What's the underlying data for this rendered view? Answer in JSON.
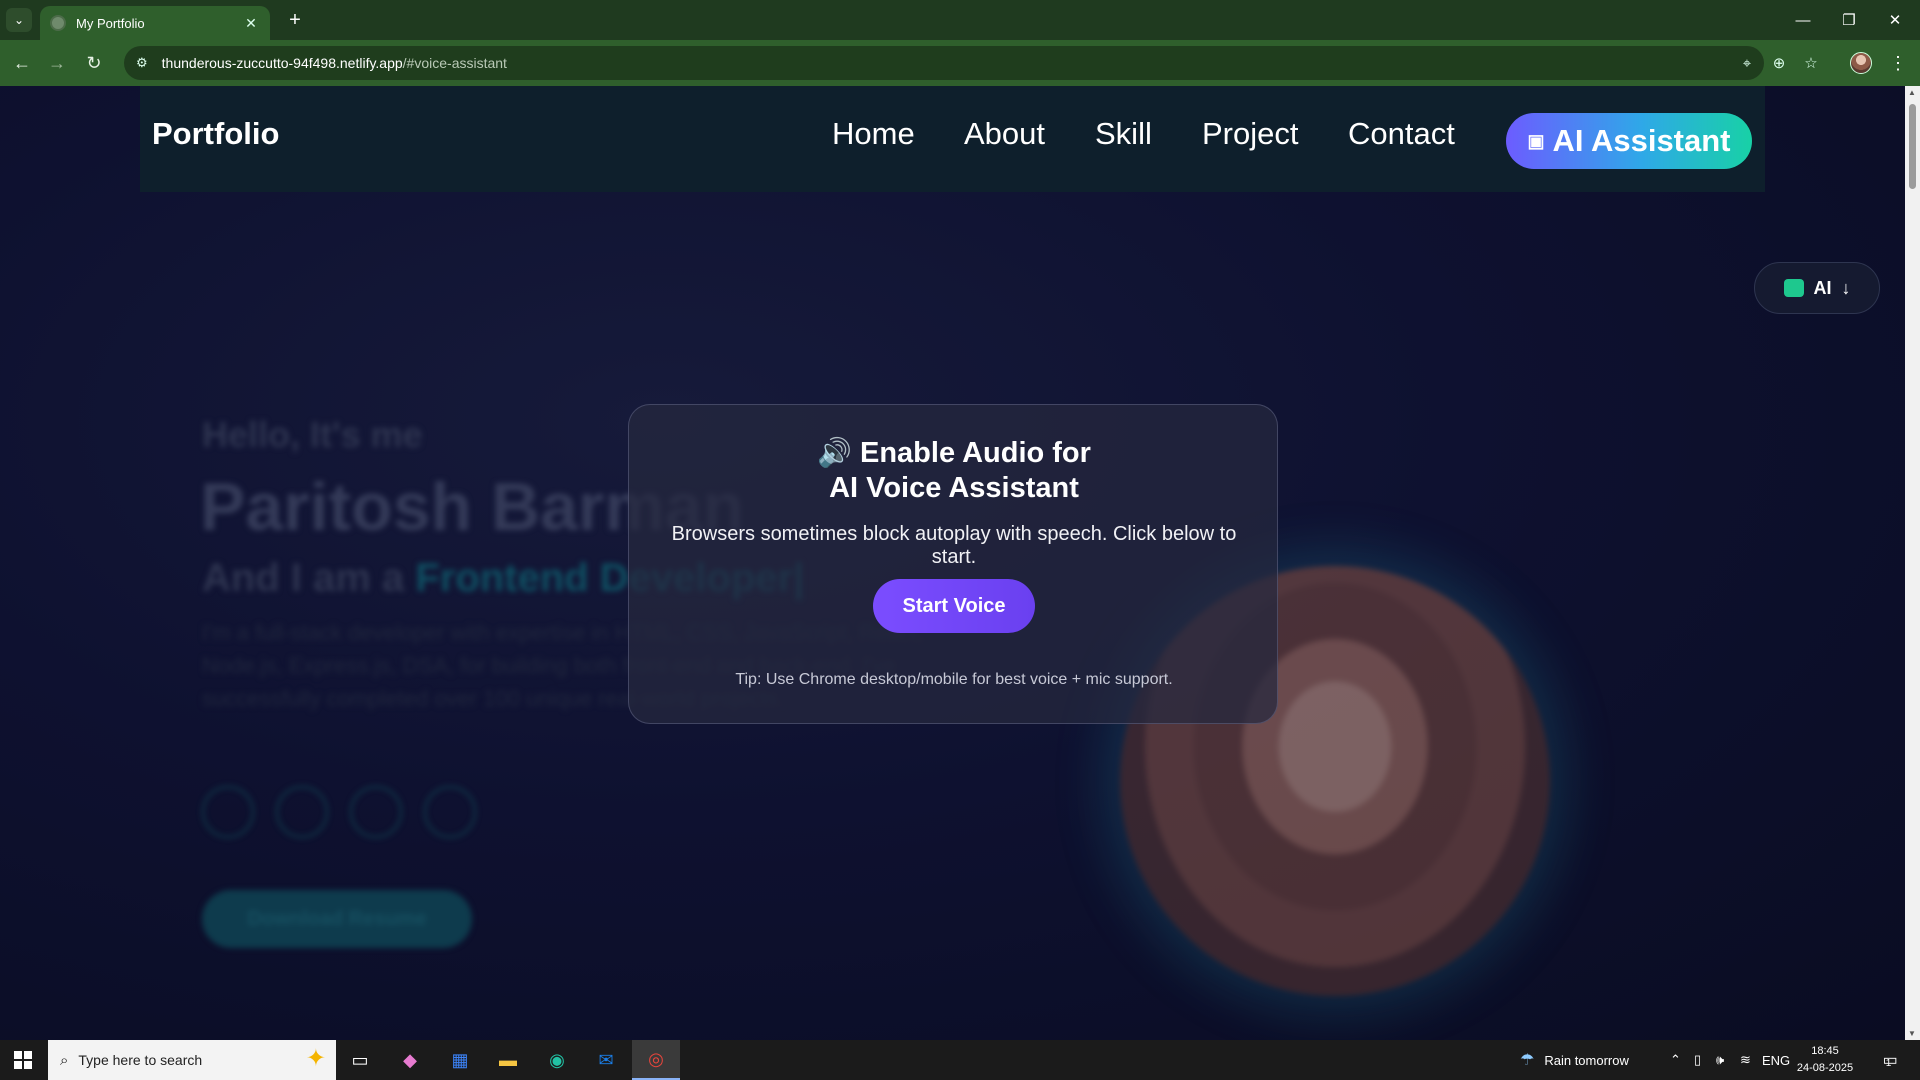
{
  "browser": {
    "tab_title": "My Portfolio",
    "url_host": "thunderous-zuccutto-94f498.netlify.app",
    "url_path": "/#voice-assistant"
  },
  "site": {
    "brand": "Portfolio",
    "nav": [
      "Home",
      "About",
      "Skill",
      "Project",
      "Contact"
    ],
    "ai_button_label": "AI Assistant",
    "ai_float_label": "AI"
  },
  "hero": {
    "hello": "Hello, It's me",
    "name": "Paritosh Barman",
    "role_prefix": "And I am a",
    "role_accent": "Frontend Developer|",
    "description": "I'm a full-stack developer with expertise in HTML, CSS, JavaScript, React, Node.js, Express.js, DSA, for building both front-end and back-end. I've successfully completed over 100 unique real-world projects.",
    "resume_label": "Download Resume"
  },
  "modal": {
    "title_line1": "Enable Audio for",
    "title_line2": "AI Voice Assistant",
    "body": "Browsers sometimes block autoplay with speech. Click below to start.",
    "button": "Start Voice",
    "tip": "Tip: Use Chrome desktop/mobile for best voice + mic support."
  },
  "taskbar": {
    "search_placeholder": "Type here to search",
    "weather": "Rain tomorrow",
    "language": "ENG",
    "time": "18:45",
    "date": "24-08-2025",
    "notification_count": "1"
  },
  "icons": {
    "tab_search": "chevron-down-icon",
    "favicon": "globe-icon",
    "site_info": "tune-icon",
    "location": "location-pin-icon",
    "zoom": "zoom-icon",
    "bookmark": "star-icon",
    "robot": "robot-icon",
    "speaker": "speaker-icon",
    "arrow_down": "arrow-down-icon"
  },
  "colors": {
    "chrome_frame": "#1f3a1f",
    "chrome_toolbar": "#2f5f2c",
    "ai_gradient_start": "#6c5cff",
    "ai_gradient_end": "#18d1a6",
    "start_voice": "#7b4dff"
  }
}
